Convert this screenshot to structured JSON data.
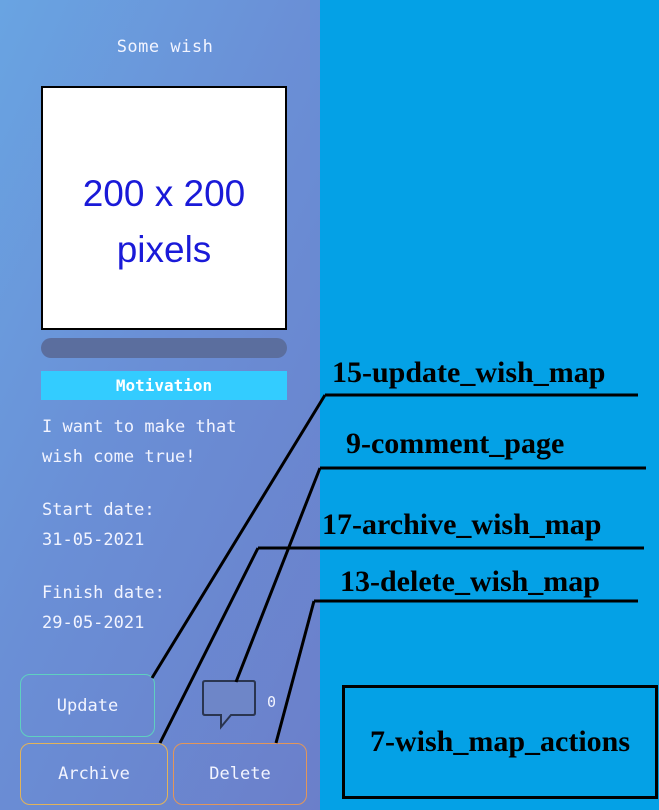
{
  "wish": {
    "title": "Some wish",
    "image_text_line1": "200 x 200",
    "image_text_line2": "pixels",
    "progress_percent": 0,
    "motivation_label": "Motivation",
    "motivation_text": "I want to make that\nwish come true!",
    "start_label": "Start date:",
    "start_date": "31-05-2021",
    "finish_label": "Finish date:",
    "finish_date": "29-05-2021"
  },
  "actions": {
    "update_label": "Update",
    "archive_label": "Archive",
    "delete_label": "Delete",
    "comment_count": "0",
    "comment_icon": "speech-bubble-icon"
  },
  "annotations": {
    "update": "15-update_wish_map",
    "comment": "9-comment_page",
    "archive": "17-archive_wish_map",
    "delete": "13-delete_wish_map",
    "actions": "7-wish_map_actions"
  },
  "colors": {
    "background": "#04a1e6",
    "motivation_bar": "#33ccff",
    "image_text": "#1a1ad8",
    "update_border": "#5fd0c0",
    "archive_border": "#e2b35a",
    "delete_border": "#e2965a"
  }
}
